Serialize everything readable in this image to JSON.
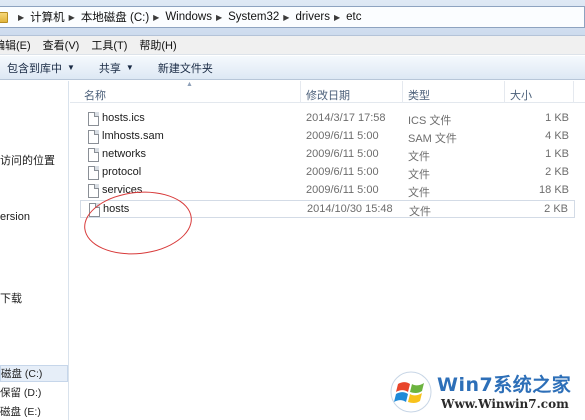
{
  "address": {
    "crumbs": [
      "计算机",
      "本地磁盘 (C:)",
      "Windows",
      "System32",
      "drivers",
      "etc"
    ]
  },
  "menu": {
    "items": [
      "编辑(E)",
      "查看(V)",
      "工具(T)",
      "帮助(H)"
    ]
  },
  "toolbar": {
    "include_label": "包含到库中",
    "share_label": "共享",
    "new_folder_label": "新建文件夹"
  },
  "nav": {
    "recent_label": "访问的位置",
    "version_label": "ersion",
    "download_label": "下载",
    "drives": [
      "磁盘 (C:)",
      "保留 (D:)",
      "磁盘 (E:)"
    ]
  },
  "columns": {
    "name": "名称",
    "date": "修改日期",
    "type": "类型",
    "size": "大小"
  },
  "files": [
    {
      "name": "hosts.ics",
      "date": "2014/3/17 17:58",
      "type": "ICS 文件",
      "size": "1 KB"
    },
    {
      "name": "lmhosts.sam",
      "date": "2009/6/11 5:00",
      "type": "SAM 文件",
      "size": "4 KB"
    },
    {
      "name": "networks",
      "date": "2009/6/11 5:00",
      "type": "文件",
      "size": "1 KB"
    },
    {
      "name": "protocol",
      "date": "2009/6/11 5:00",
      "type": "文件",
      "size": "2 KB"
    },
    {
      "name": "services",
      "date": "2009/6/11 5:00",
      "type": "文件",
      "size": "18 KB"
    },
    {
      "name": "hosts",
      "date": "2014/10/30 15:48",
      "type": "文件",
      "size": "2 KB"
    }
  ],
  "watermark": {
    "title": "Win7系统之家",
    "url": "Www.Winwin7.com"
  },
  "colors": {
    "annotation": "#d83a3a",
    "watermark_blue": "#2d6fb8",
    "selection_border": "#d3dbe6"
  }
}
